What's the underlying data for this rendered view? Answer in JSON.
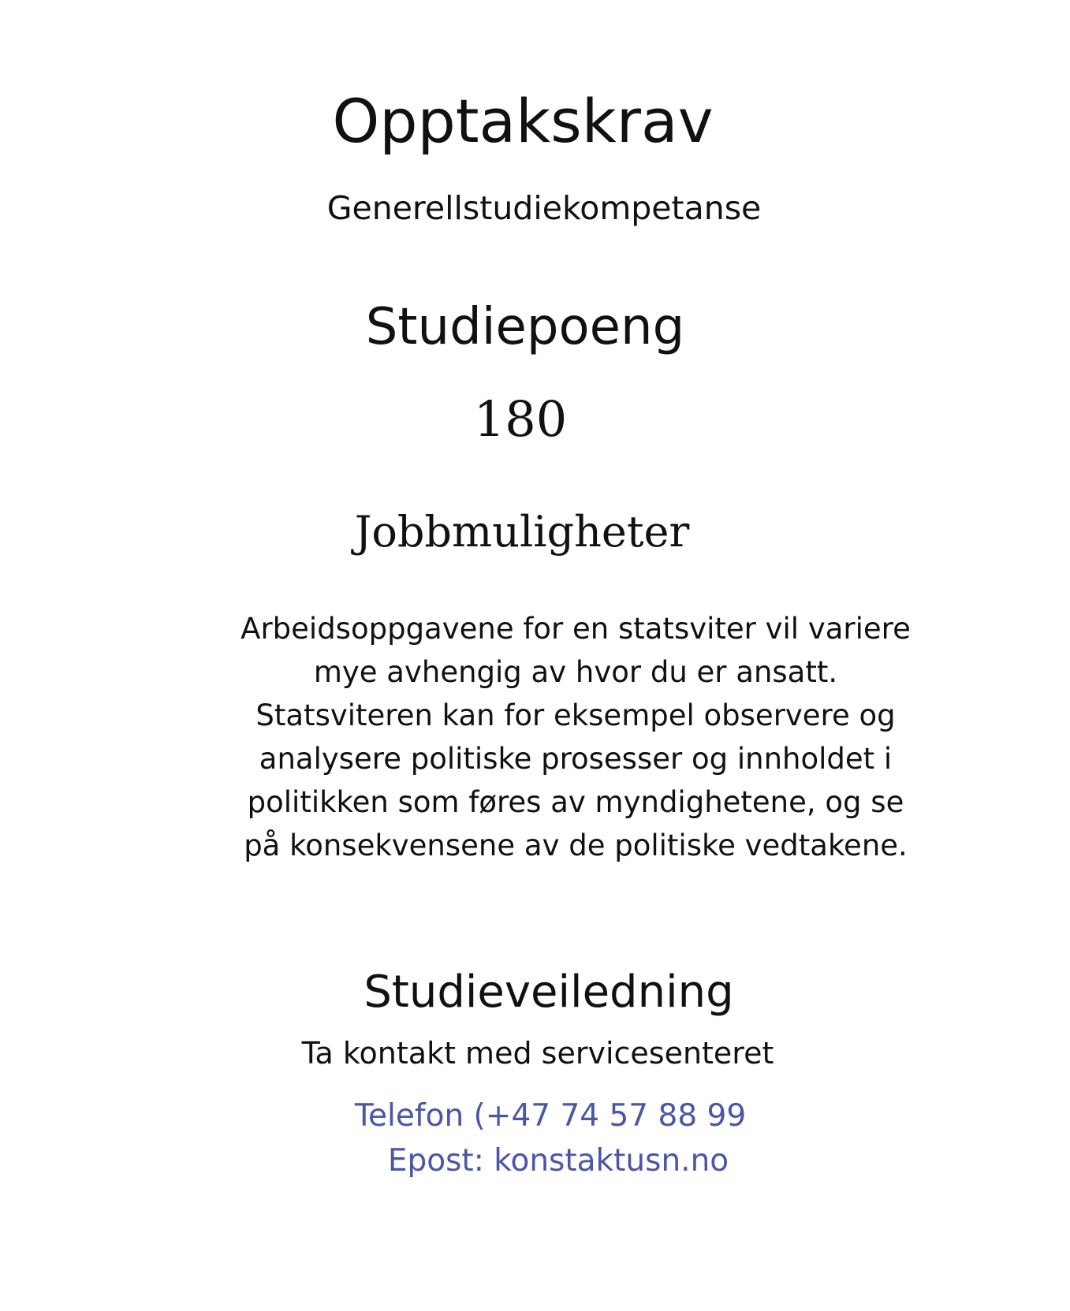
{
  "admission": {
    "heading": "Opptakskrav",
    "requirement": "Generellstudiekompetanse"
  },
  "credits": {
    "heading": "Studiepoeng",
    "value": "180"
  },
  "jobs": {
    "heading": "Jobbmuligheter",
    "lines": [
      "Arbeidsoppgavene for en statsviter vil variere",
      "mye avhengig av hvor du er ansatt.",
      "Statsviteren kan for eksempel observere og",
      "analysere politiske prosesser og innholdet i",
      "politikken som føres av myndighetene, og se",
      "på konsekvensene av de politiske vedtakene."
    ]
  },
  "guidance": {
    "heading": "Studieveiledning",
    "lead": "Ta kontakt med servicesenteret",
    "phone": "Telefon (+47 74 57 88 99",
    "email": "Epost: konstaktusn.no"
  },
  "colors": {
    "text": "#111111",
    "link": "#4a56a6",
    "background": "#ffffff"
  }
}
